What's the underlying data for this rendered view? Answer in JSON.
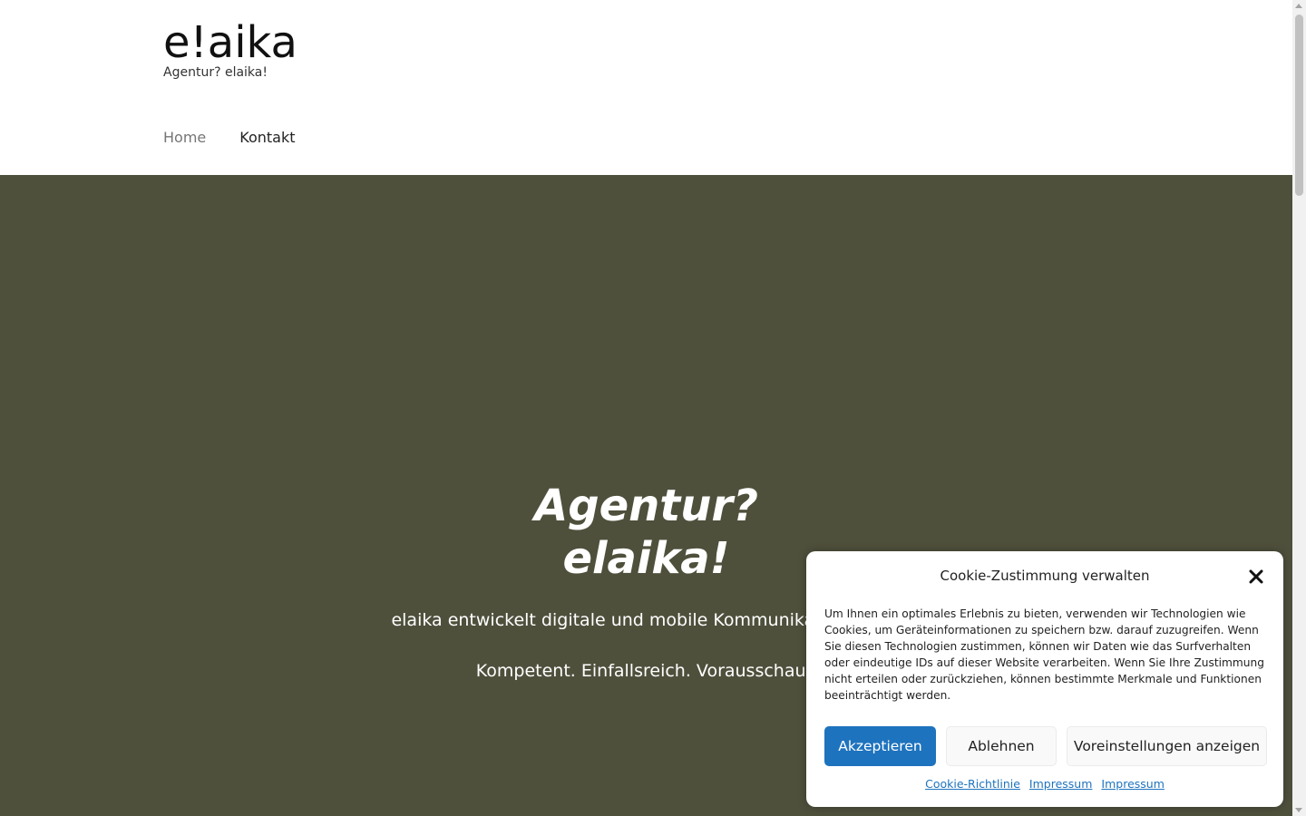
{
  "header": {
    "logo": {
      "prefix": "e",
      "bang": "!",
      "suffix": "aika"
    },
    "tagline": "Agentur? elaika!",
    "nav": {
      "home": "Home",
      "kontakt": "Kontakt"
    }
  },
  "hero": {
    "title_line1": "Agentur?",
    "title_line2": "elaika!",
    "text_line1": "elaika entwickelt digitale und mobile Kommunikations- und",
    "text_line2": "Kompetent. Einfallsreich. Vorausschaue"
  },
  "cookie": {
    "title": "Cookie-Zustimmung verwalten",
    "body": "Um Ihnen ein optimales Erlebnis zu bieten, verwenden wir Technologien wie Cookies, um Geräteinformationen zu speichern bzw. darauf zuzugreifen. Wenn Sie diesen Technologien zustimmen, können wir Daten wie das Surfverhalten oder eindeutige IDs auf dieser Website verarbeiten. Wenn Sie Ihre Zustimmung nicht erteilen oder zurückziehen, können bestimmte Merkmale und Funktionen beeinträchtigt werden.",
    "accept": "Akzeptieren",
    "deny": "Ablehnen",
    "preferences": "Voreinstellungen anzeigen",
    "links": [
      "Cookie-Richtlinie",
      "Impressum",
      "Impressum"
    ]
  },
  "colors": {
    "hero_bg": "#4f503c",
    "accent": "#1e73be"
  },
  "icons": {
    "close": "close-icon"
  }
}
